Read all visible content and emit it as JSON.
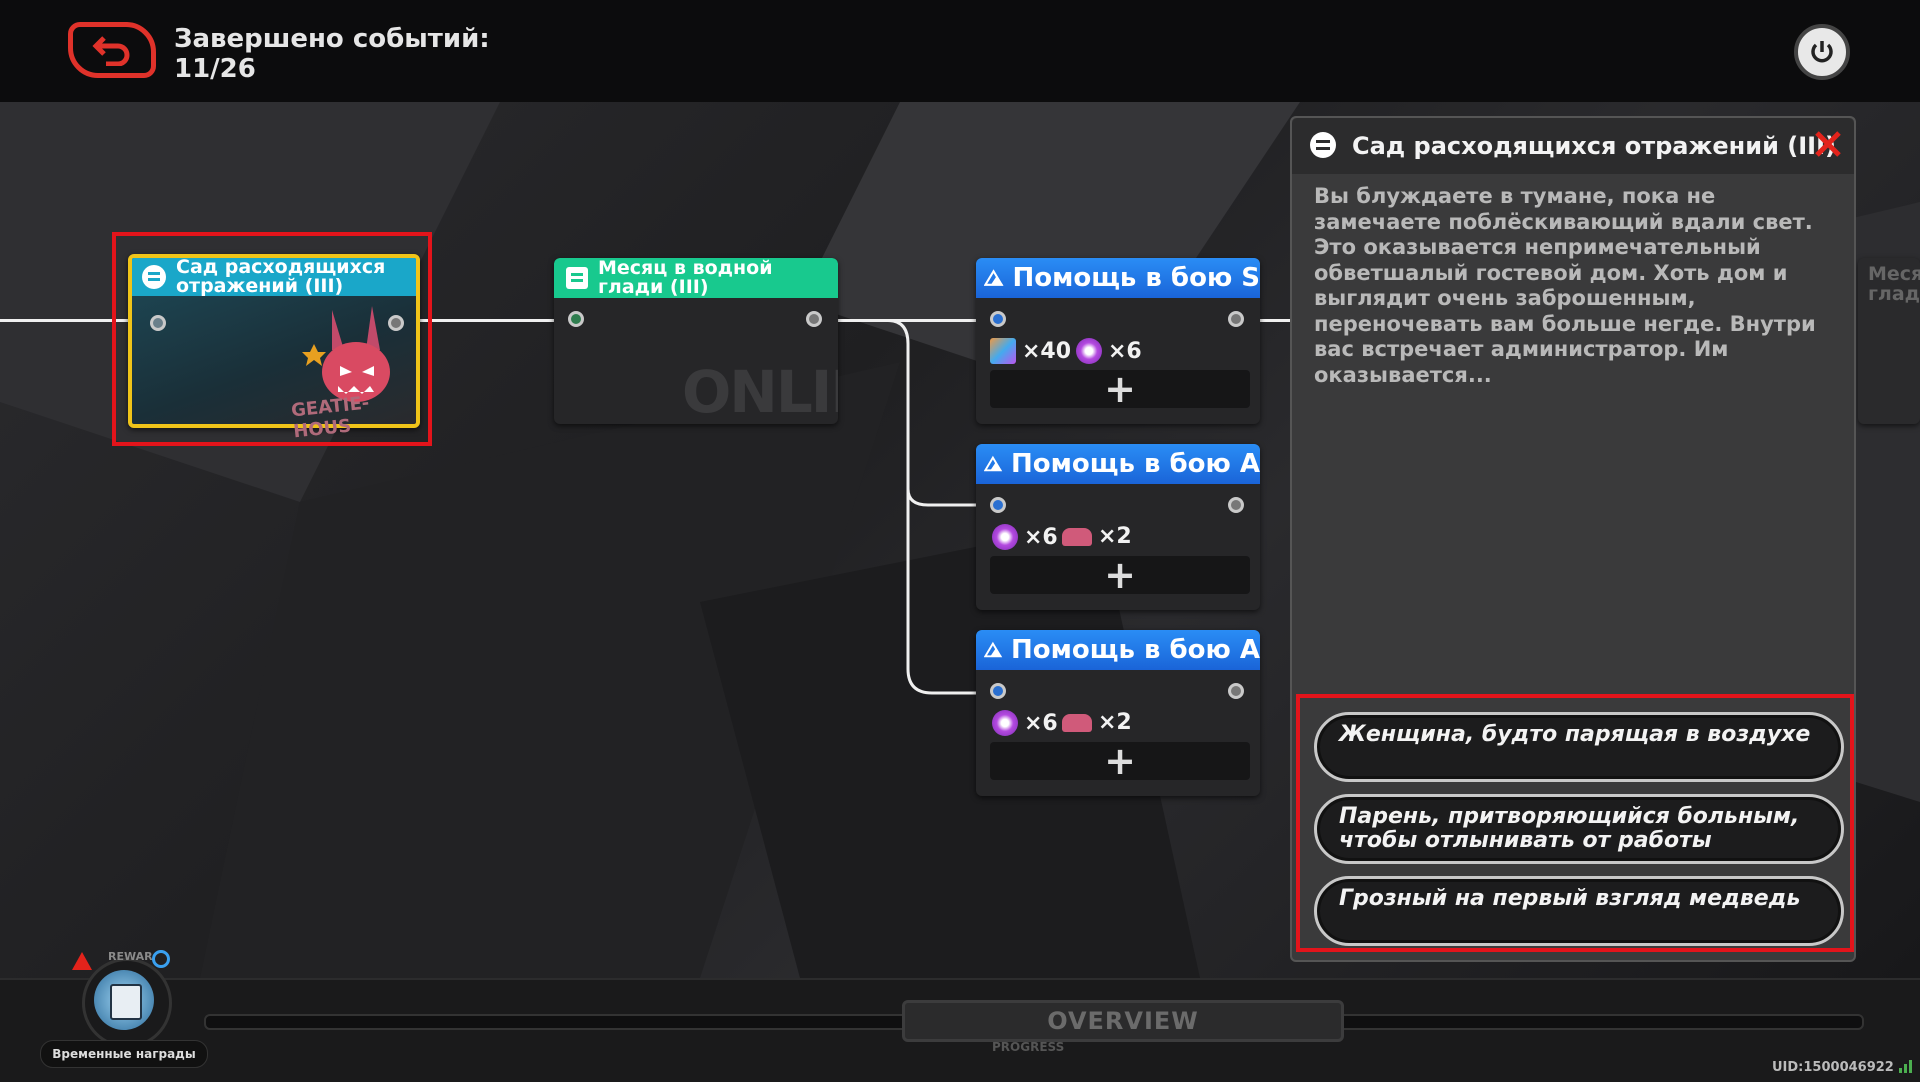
{
  "header": {
    "events_label": "Завершено событий:",
    "events_count": "11/26"
  },
  "nodes": [
    {
      "title": "Сад расходящихся отражений (III)",
      "type": "story",
      "color": "#1aa7c9",
      "selected": true
    },
    {
      "title": "Месяц в водной глади (III)",
      "type": "story",
      "color": "#18c98e",
      "watermark": "ONLIN"
    },
    {
      "title": "Помощь в бою S",
      "type": "combat",
      "color": "#1f7bef",
      "rewards": [
        {
          "icon": "film-icon",
          "qty": "×40"
        },
        {
          "icon": "polychrome-icon",
          "qty": "×6"
        }
      ]
    },
    {
      "title": "Помощь в бою A",
      "type": "combat",
      "color": "#1f7bef",
      "rewards": [
        {
          "icon": "polychrome-icon",
          "qty": "×6"
        },
        {
          "icon": "car-icon",
          "qty": "×2"
        }
      ]
    },
    {
      "title": "Помощь в бою A",
      "type": "combat",
      "color": "#1f7bef",
      "rewards": [
        {
          "icon": "polychrome-icon",
          "qty": "×6"
        },
        {
          "icon": "car-icon",
          "qty": "×2"
        }
      ]
    }
  ],
  "node_art_text": "GEATIE-HOUS",
  "partial_node_text": "Меся\nглад",
  "panel": {
    "title": "Сад расходящихся отражений (III)",
    "description": "Вы блуждаете в тумане, пока не замечаете поблёскивающий вдали свет. Это оказывается непримечательный обветшалый гостевой дом. Хоть дом и выглядит очень заброшенным, переночевать вам больше негде. Внутри вас встречает администратор. Им оказывается...",
    "options": [
      "Женщина, будто парящая в воздухе",
      "Парень, притворяющийся больным, чтобы отлынивать от работы",
      "Грозный на первый взгляд медведь"
    ]
  },
  "bottom": {
    "rewards_badge": "REWAR",
    "rewards_label": "Временные награды",
    "overview_label": "OVERVIEW",
    "progress_label": "PROGRESS",
    "uid": "UID:1500046922"
  },
  "colors": {
    "accent_red": "#e3141b",
    "selected_yellow": "#f0c419"
  }
}
